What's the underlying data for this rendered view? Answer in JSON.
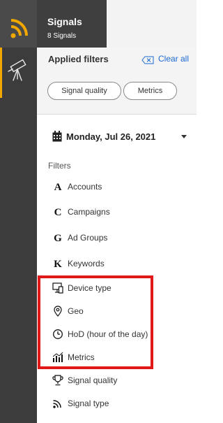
{
  "app": {
    "title": "Signals",
    "subtitle": "8 Signals"
  },
  "applied_filters": {
    "title": "Applied filters",
    "clear_label": "Clear all",
    "chips": [
      "Signal quality",
      "Metrics"
    ]
  },
  "date": {
    "label": "Monday, Jul 26, 2021"
  },
  "filters": {
    "title": "Filters",
    "items": [
      {
        "label": "Accounts",
        "icon": "letter-a-icon"
      },
      {
        "label": "Campaigns",
        "icon": "letter-c-icon"
      },
      {
        "label": "Ad Groups",
        "icon": "letter-g-icon"
      },
      {
        "label": "Keywords",
        "icon": "letter-k-icon"
      },
      {
        "label": "Device type",
        "icon": "device-icon"
      },
      {
        "label": "Geo",
        "icon": "location-pin-icon"
      },
      {
        "label": "HoD (hour of the day)",
        "icon": "clock-icon"
      },
      {
        "label": "Metrics",
        "icon": "chart-icon"
      },
      {
        "label": "Signal quality",
        "icon": "trophy-icon"
      },
      {
        "label": "Signal type",
        "icon": "rss-icon"
      }
    ]
  },
  "colors": {
    "accent": "#f0a800",
    "link": "#1c6ad4",
    "highlight": "#e01818",
    "rail": "#3c3c3c"
  }
}
